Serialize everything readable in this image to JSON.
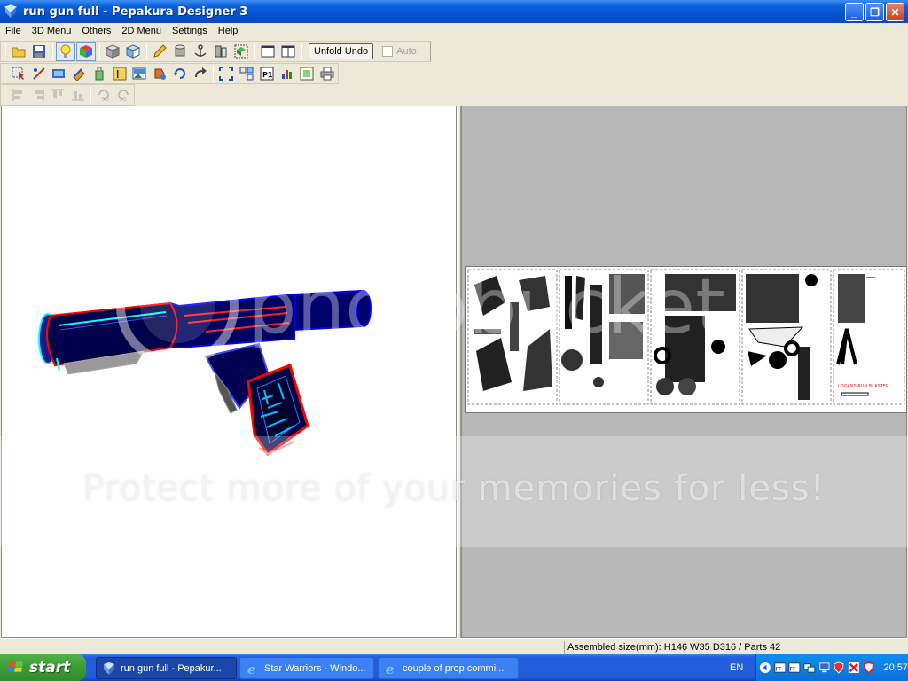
{
  "window": {
    "title": "run gun full - Pepakura Designer 3",
    "minimize_label": "_",
    "maximize_label": "❐",
    "close_label": "✕"
  },
  "menu": {
    "items": [
      "File",
      "3D Menu",
      "Others",
      "2D Menu",
      "Settings",
      "Help"
    ]
  },
  "toolbar": {
    "unfold_undo_label": "Unfold Undo",
    "auto_label": "Auto",
    "rotate_left_label": "90",
    "rotate_right_label": "90"
  },
  "sheet": {
    "part_label": "LOGANS RUN BLASTER"
  },
  "watermark": {
    "brand": "photobucket",
    "slogan": "Protect more of your memories for less!"
  },
  "status": {
    "assembled_size": "Assembled size(mm): H146 W35 D316 / Parts 42"
  },
  "taskbar": {
    "start_label": "start",
    "tasks": [
      {
        "label": "run gun full - Pepakur..."
      },
      {
        "label": "Star Warriors - Windo..."
      },
      {
        "label": "couple of prop commi..."
      }
    ],
    "language": "EN",
    "clock": "20:57"
  },
  "colors": {
    "model_body": "#000080",
    "model_edge": "#ff0000",
    "model_highlight": "#00ffff",
    "xp_blue": "#245edc",
    "start_green": "#3c9b37"
  }
}
